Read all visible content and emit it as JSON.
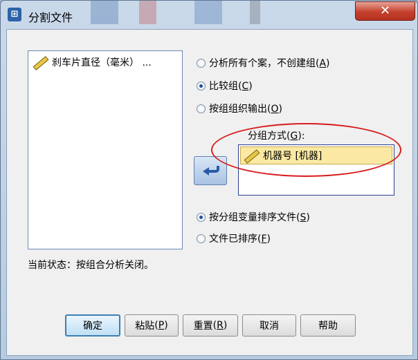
{
  "window": {
    "title": "分割文件",
    "app_icon": "spss-split-icon",
    "close_glyph": "✕"
  },
  "variables": {
    "items": [
      {
        "label": "刹车片直径（毫米） ...",
        "icon": "ruler-scale-icon"
      }
    ]
  },
  "options": {
    "analyze_all": {
      "label": "分析所有个案，不创建组",
      "key": "A"
    },
    "compare_groups": {
      "label": "比较组",
      "key": "C"
    },
    "organize_by_group": {
      "label": "按组组织输出",
      "key": "O"
    }
  },
  "group_by": {
    "label": "分组方式",
    "key": "G",
    "items": [
      {
        "label": "机器号 [机器]",
        "icon": "ruler-scale-icon"
      }
    ]
  },
  "sort": {
    "sort_file": {
      "label": "按分组变量排序文件",
      "key": "S"
    },
    "already_sorted": {
      "label": "文件已排序",
      "key": "F"
    }
  },
  "status": "当前状态：按组合分析关闭。",
  "buttons": {
    "ok": "确定",
    "paste": {
      "label": "粘贴",
      "key": "P"
    },
    "reset": {
      "label": "重置",
      "key": "R"
    },
    "cancel": "取消",
    "help": "帮助"
  },
  "selected": {
    "mode": "compare_groups",
    "sort": "sort_file"
  },
  "colors": {
    "accent": "#2a5aa6",
    "highlight": "#fbe9a3",
    "annotation": "#d81c1c",
    "close": "#c4402c"
  }
}
